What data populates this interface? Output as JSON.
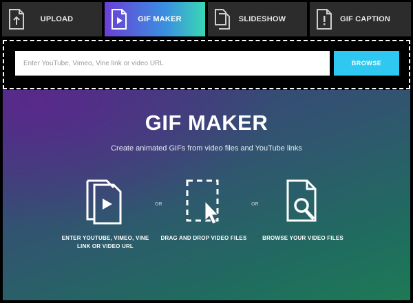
{
  "tabs": [
    {
      "label": "UPLOAD",
      "icon": "upload-file-icon",
      "active": false
    },
    {
      "label": "GIF MAKER",
      "icon": "video-file-icon",
      "active": true
    },
    {
      "label": "SLIDESHOW",
      "icon": "slideshow-icon",
      "active": false
    },
    {
      "label": "GIF CAPTION",
      "icon": "caption-alert-icon",
      "active": false
    }
  ],
  "url_input": {
    "placeholder": "Enter YouTube, Vimeo, Vine link or video URL",
    "value": ""
  },
  "browse_button": {
    "label": "BROWSE"
  },
  "hero": {
    "title": "GIF MAKER",
    "subtitle": "Create animated GIFs from video files and YouTube links",
    "options": [
      {
        "icon": "video-files-icon",
        "label": "ENTER YOUTUBE, VIMEO, VINE LINK OR VIDEO URL"
      },
      {
        "icon": "drag-drop-cursor-icon",
        "label": "DRAG AND DROP VIDEO FILES"
      },
      {
        "icon": "browse-search-file-icon",
        "label": "BROWSE YOUR VIDEO FILES"
      }
    ],
    "separator": "OR"
  },
  "colors": {
    "active_tab_start": "#6b3fd6",
    "active_tab_end": "#39d7b5",
    "browse_button": "#2ec8f2",
    "tab_background": "#2c2c2c"
  }
}
